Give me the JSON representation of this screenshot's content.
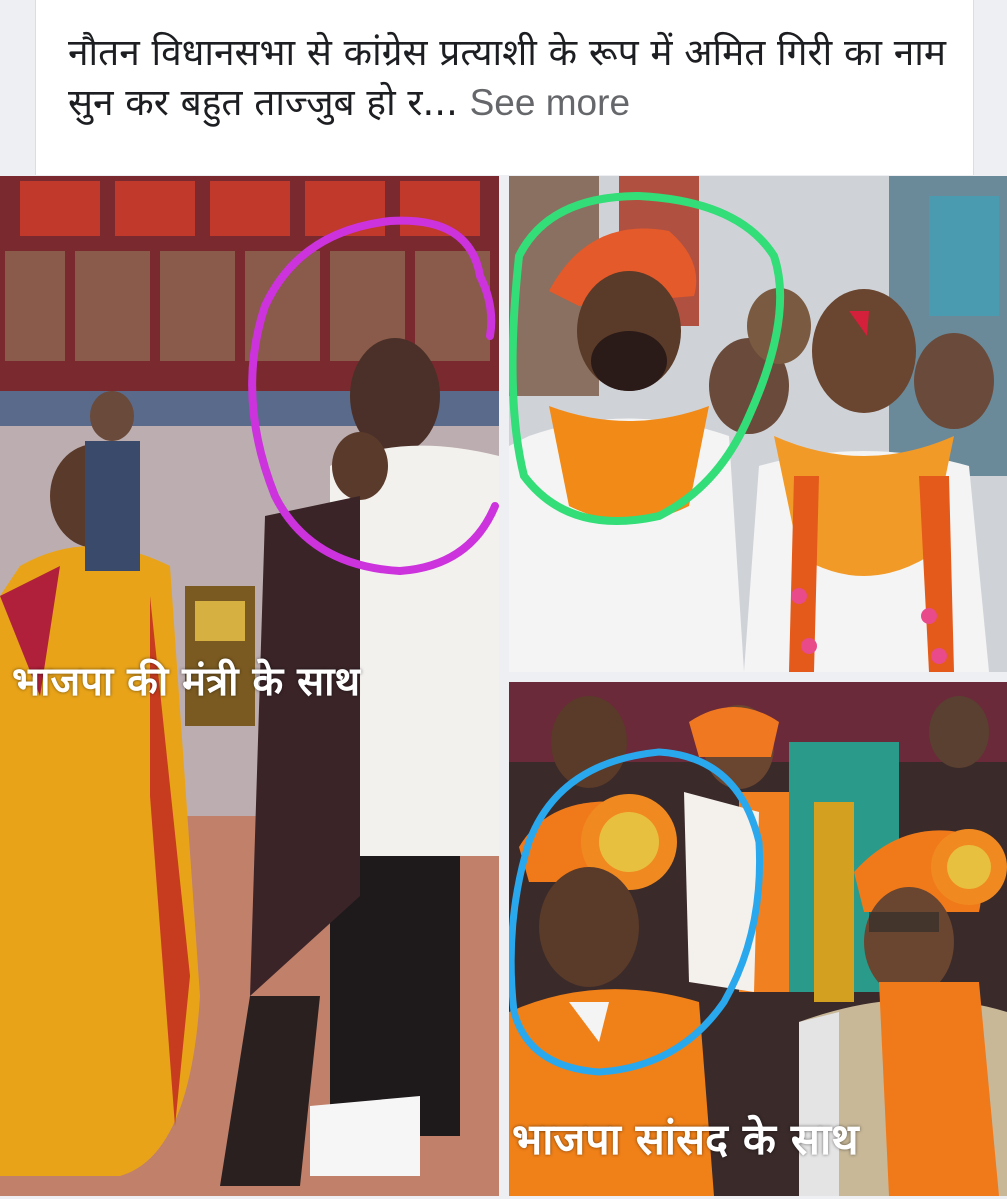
{
  "post": {
    "text": "नौतन विधानसभा से कांग्रेस प्रत्याशी के रूप में अमित गिरी का नाम सुन कर बहुत ताज्जुब हो र...",
    "see_more": "See more"
  },
  "photos": [
    {
      "caption": "भाजपा की मंत्री के साथ",
      "highlight_color": "#cc33dd"
    },
    {
      "caption": "",
      "highlight_color": "#33dd77"
    },
    {
      "caption": "भाजपा सांसद के साथ",
      "highlight_color": "#2aa8ee"
    }
  ],
  "colors": {
    "background": "#eeeff3",
    "card": "#ffffff",
    "text": "#1c1e21",
    "muted": "#65676b"
  }
}
